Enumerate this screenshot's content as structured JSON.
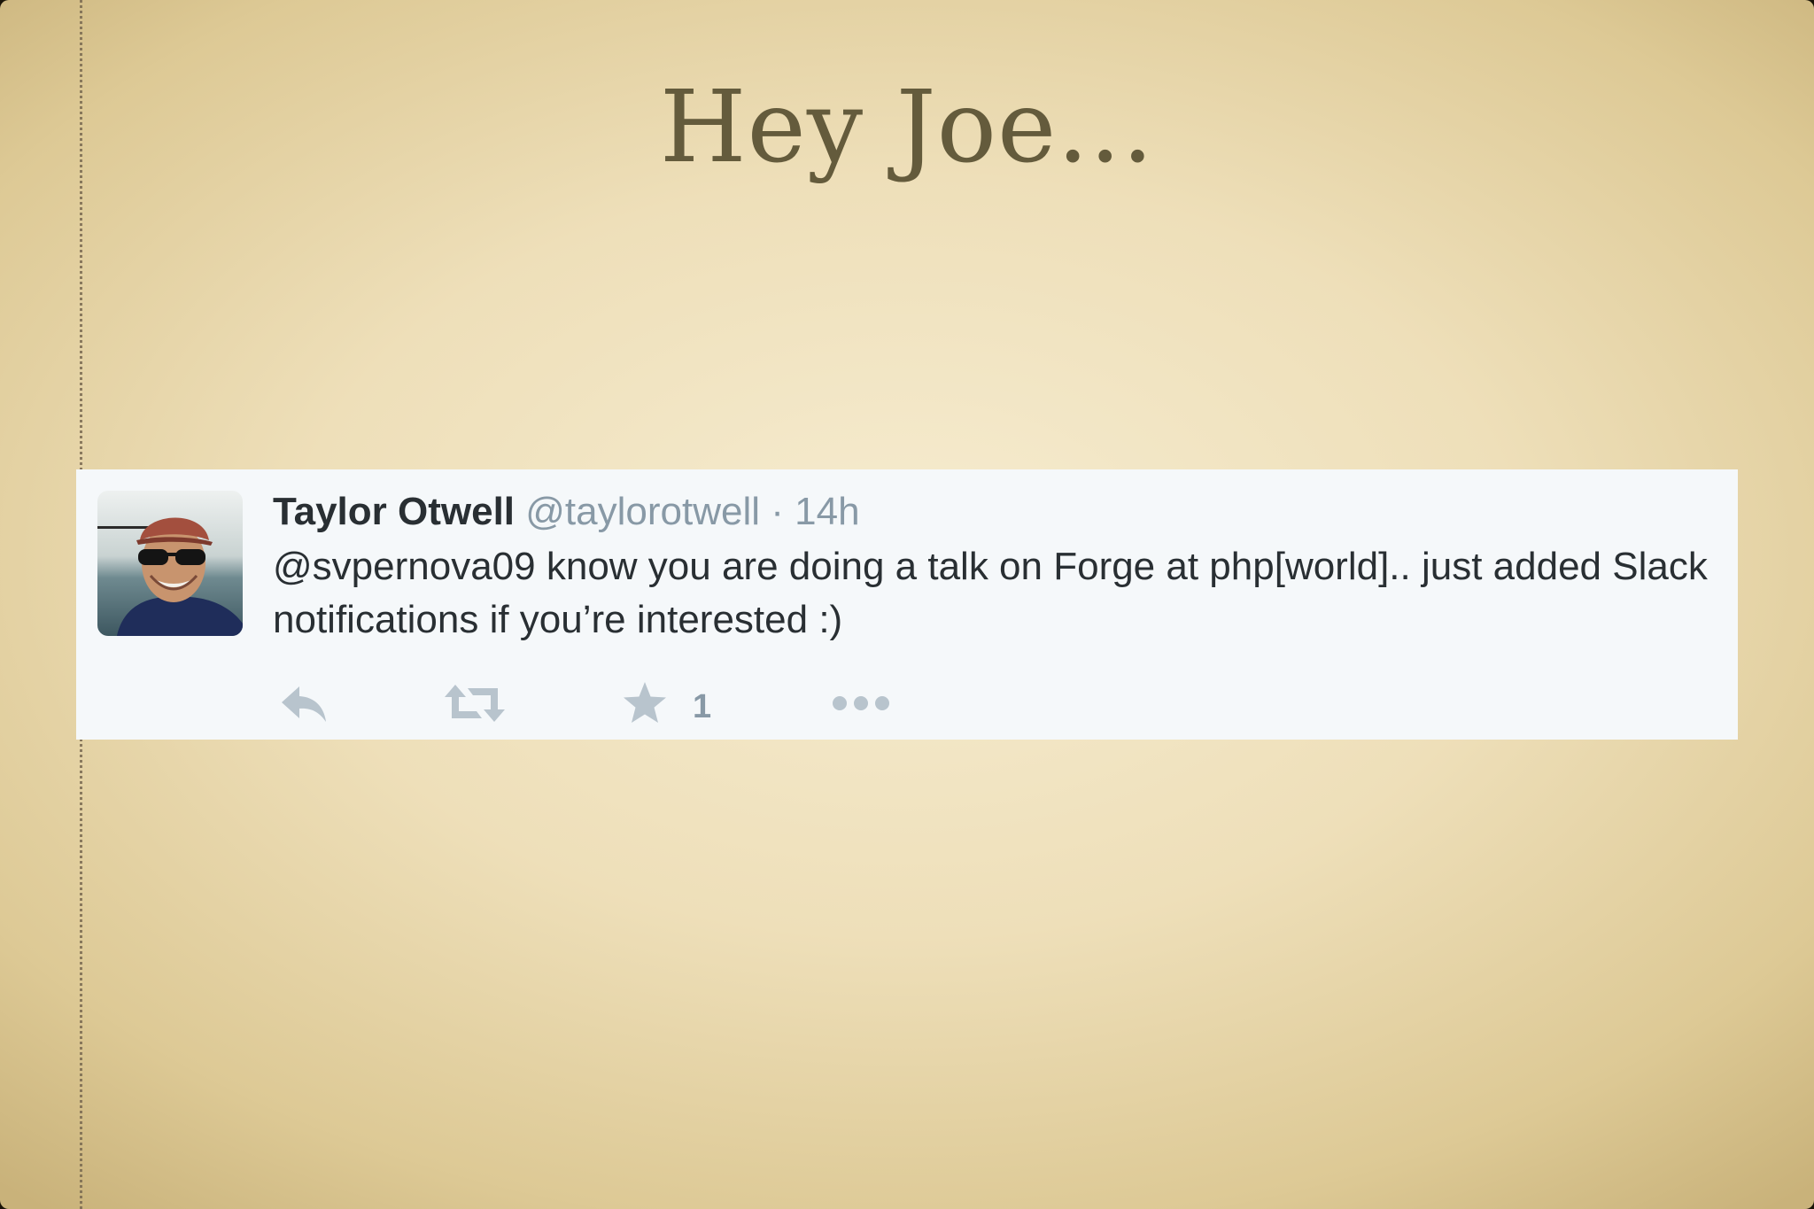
{
  "slide": {
    "title": "Hey Joe..."
  },
  "tweet": {
    "author_name": "Taylor Otwell",
    "handle": "@taylorotwell",
    "separator": "·",
    "time": "14h",
    "mention": "@svpernova09",
    "text": " know you are doing a talk on Forge at php[world].. just added Slack notifications if you’re interested :)",
    "favorite_count": "1",
    "actions": [
      {
        "icon": "reply-icon"
      },
      {
        "icon": "retweet-icon"
      },
      {
        "icon": "star-icon"
      },
      {
        "icon": "more-icon"
      }
    ]
  },
  "colors": {
    "action_gray": "#b8c4cd",
    "muted_text": "#8899a6",
    "title_text": "#645b3c",
    "card_bg": "#f5f8fa"
  }
}
